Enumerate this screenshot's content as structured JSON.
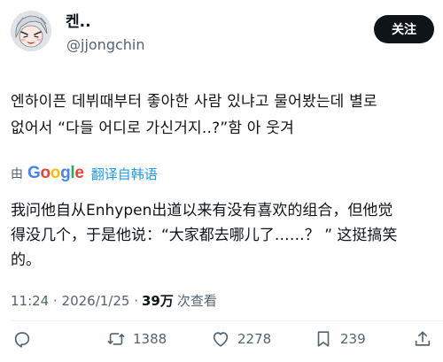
{
  "user": {
    "display_name": "켄..",
    "handle": "@jjongchin",
    "follow_label": "关注"
  },
  "tweet": {
    "lines": [
      "엔하이픈 데뷔때부터 좋아한 사람 있냐고 물어봤는데 별로",
      "없어서 “다들 어디로 가신거지..?”함 아 웃겨"
    ]
  },
  "translation": {
    "by_label": "由",
    "provider": "Google",
    "link_label": "翻译自韩语",
    "lines": [
      "我问他自从Enhypen出道以来有没有喜欢的组合，但他觉",
      "得没几个，于是他说：“大家都去哪儿了……？ ” 这挺搞笑",
      "的。"
    ]
  },
  "meta": {
    "time": "11:24 · 2026/1/25 ·",
    "views_count": "39万",
    "views_label": "次查看"
  },
  "actions": {
    "replies": "",
    "retweets": "1388",
    "likes": "2278",
    "bookmarks": "239"
  },
  "colors": {
    "text": "#0f1419",
    "secondary": "#536471",
    "link": "#1d9bf0",
    "button_bg": "#0f1419"
  },
  "icons": [
    "avatar-image",
    "reply-icon",
    "retweet-icon",
    "like-icon",
    "bookmark-icon",
    "share-icon"
  ]
}
